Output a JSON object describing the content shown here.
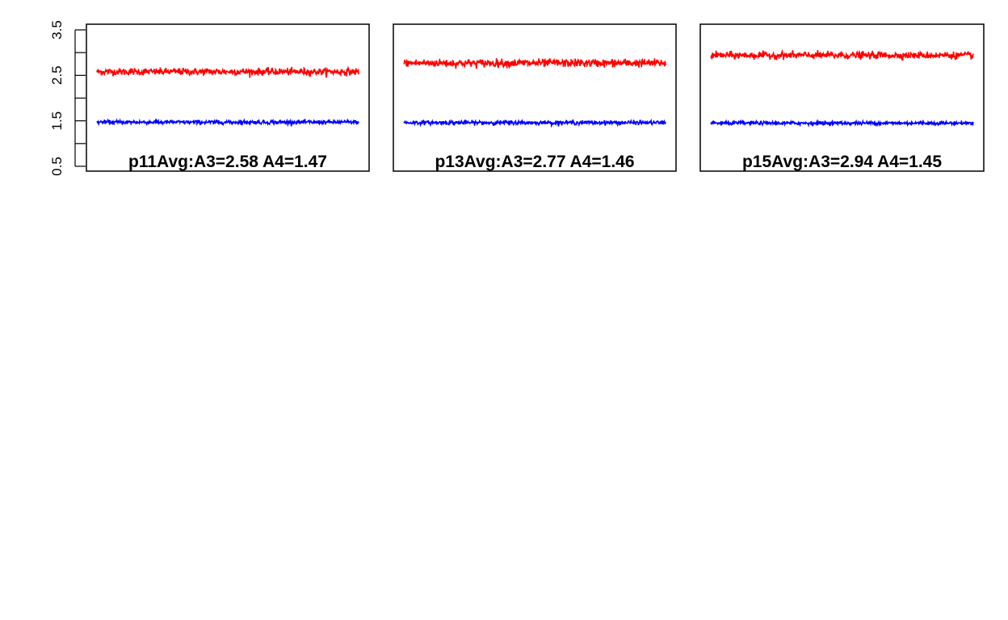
{
  "chart_data": [
    {
      "type": "line",
      "title": "p11Avg:A3=2.58 A4=1.47",
      "xlabel": "",
      "ylabel": "",
      "ylim": [
        0.5,
        3.5
      ],
      "yticks": [
        "0.5",
        "1.5",
        "2.5",
        "3.5"
      ],
      "show_yaxis": true,
      "grid": false,
      "series": [
        {
          "color": "#ff0000",
          "mean": 2.58,
          "noise": 0.07
        },
        {
          "color": "#0000ff",
          "mean": 1.47,
          "noise": 0.04
        }
      ]
    },
    {
      "type": "line",
      "title": "p13Avg:A3=2.77 A4=1.46",
      "xlabel": "",
      "ylabel": "",
      "ylim": [
        0.5,
        3.5
      ],
      "show_yaxis": false,
      "grid": false,
      "series": [
        {
          "color": "#ff0000",
          "mean": 2.77,
          "noise": 0.08
        },
        {
          "color": "#0000ff",
          "mean": 1.46,
          "noise": 0.04
        }
      ]
    },
    {
      "type": "line",
      "title": "p15Avg:A3=2.94 A4=1.45",
      "xlabel": "",
      "ylabel": "",
      "ylim": [
        0.5,
        3.5
      ],
      "show_yaxis": false,
      "grid": false,
      "series": [
        {
          "color": "#ff0000",
          "mean": 2.94,
          "noise": 0.07
        },
        {
          "color": "#0000ff",
          "mean": 1.45,
          "noise": 0.035
        }
      ]
    }
  ]
}
